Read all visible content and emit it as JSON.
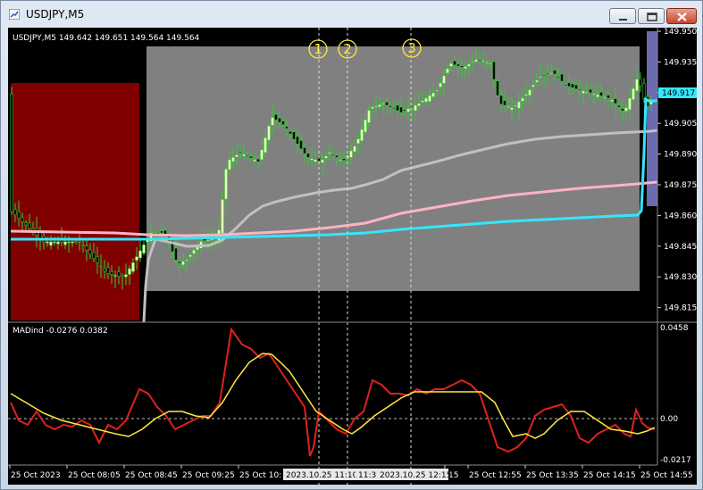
{
  "window": {
    "title": "USDJPY,M5",
    "icon": "chart-app-icon",
    "controls": [
      "minimize-icon",
      "maximize-icon",
      "close-icon"
    ]
  },
  "main_chart": {
    "header": "USDJPY,M5  149.642 149.651 149.564 149.564",
    "price_ticks": [
      "149.950",
      "149.935",
      "149.920",
      "149.905",
      "149.890",
      "149.875",
      "149.860",
      "149.845",
      "149.830",
      "149.815"
    ],
    "price_marker": "149.917",
    "markers": [
      "1",
      "2",
      "3"
    ]
  },
  "indicator": {
    "header": "MADind -0.0276 0.0382",
    "ticks": [
      "0.0458",
      "0.00",
      "-0.0217"
    ]
  },
  "time_axis": {
    "labels": [
      "25 Oct 2023",
      "25 Oct 08:05",
      "25 Oct 08:45",
      "25 Oct 09:25",
      "25 Oct 10:",
      "",
      ":15",
      "25 Oct 12:55",
      "25 Oct 13:35",
      "25 Oct 14:15",
      "25 Oct 14:55"
    ],
    "crosshair_labels": [
      "2023.10.25 11:10",
      "11:3",
      "2023.10.25 12:15"
    ]
  },
  "colors": {
    "background": "#000000",
    "session_dark": "#800000",
    "session_gray": "#808080",
    "session_purple": "#6b6bb0",
    "bull_candle": "#e6ffb3",
    "bear_candle": "#0a0a0a",
    "wick": "#33cc33",
    "ma_cyan": "#33e6ff",
    "ma_pink": "#ffb3c1",
    "ma_silver": "#c0c0c0",
    "osc_red": "#e02020",
    "osc_yellow": "#ffeb3b"
  }
}
